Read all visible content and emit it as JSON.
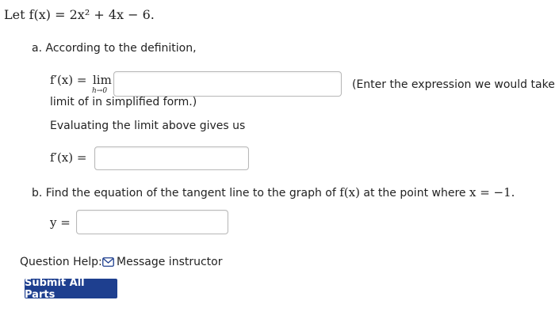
{
  "problem": {
    "intro": "Let f(x) = 2x² + 4x − 6."
  },
  "part_a": {
    "label": "a.",
    "prompt": "According to the definition,",
    "lhs": "f′(x) =",
    "lim": "lim",
    "lim_sub": "h→0",
    "hint": "(Enter the expression we would take the",
    "hint_cont": "limit of in simplified form.)",
    "input1_value": "",
    "evaluate_text": "Evaluating the limit above gives us",
    "lhs2": "f′(x) =",
    "input2_value": ""
  },
  "part_b": {
    "label": "b.",
    "prompt_pre": "Find the equation of the tangent line to the graph of",
    "fx": "f(x)",
    "prompt_mid": "at the point where",
    "condition": "x = −1.",
    "lhs": "y =",
    "input_value": ""
  },
  "help": {
    "label": "Question Help:",
    "message_link": "Message instructor",
    "icon": "envelope-icon"
  },
  "submit": {
    "label": "Submit All Parts"
  },
  "colors": {
    "accent": "#1e3f8f"
  }
}
